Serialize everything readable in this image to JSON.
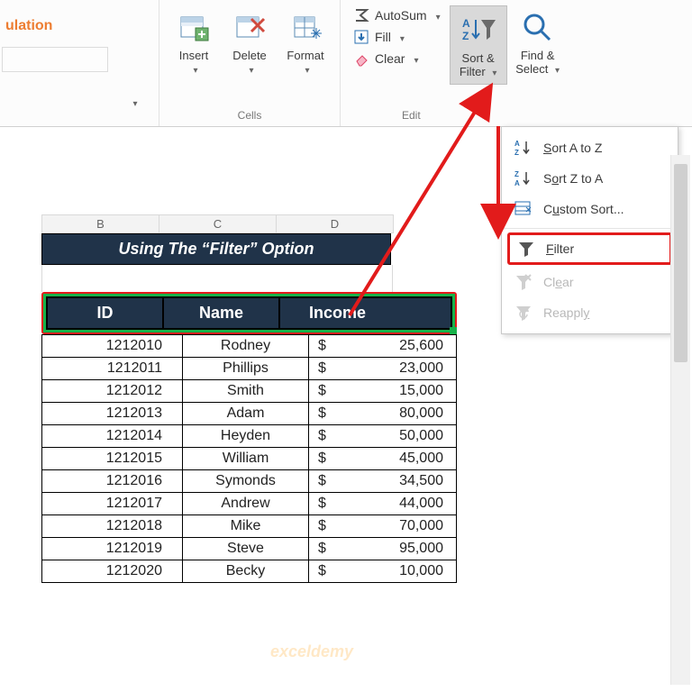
{
  "leftfrag": {
    "line1": "ulation"
  },
  "ribbon": {
    "cells": {
      "insert": "Insert",
      "delete": "Delete",
      "format": "Format",
      "label": "Cells"
    },
    "editing": {
      "autosum": "AutoSum",
      "fill": "Fill",
      "clear": "Clear",
      "sortfilter_l1": "Sort &",
      "sortfilter_l2": "Filter",
      "findselect_l1": "Find &",
      "findselect_l2": "Select",
      "label": "Edit"
    }
  },
  "dropdown": {
    "sort_az_pre": "S",
    "sort_az_rest": "ort A to Z",
    "sort_za_pre": "S",
    "sort_za_mid": "o",
    "sort_za_rest": "rt Z to A",
    "custom_pre": "C",
    "custom_mid": "u",
    "custom_rest": "stom Sort...",
    "filter_pre": "",
    "filter_u": "F",
    "filter_rest": "ilter",
    "clear_pre": "Cl",
    "clear_u": "e",
    "clear_rest": "ar",
    "reapply_pre": "Reappl",
    "reapply_u": "y",
    "reapply_rest": ""
  },
  "sheet": {
    "cols": [
      "B",
      "C",
      "D"
    ],
    "banner": "Using The “Filter” Option",
    "headers": [
      "ID",
      "Name",
      "Income"
    ]
  },
  "watermark": "exceldemy",
  "chart_data": {
    "type": "table",
    "title": "Using The “Filter” Option",
    "columns": [
      "ID",
      "Name",
      "Income"
    ],
    "rows": [
      {
        "id": "1212010",
        "name": "Rodney",
        "income": 25600,
        "income_display": "25,600"
      },
      {
        "id": "1212011",
        "name": "Phillips",
        "income": 23000,
        "income_display": "23,000"
      },
      {
        "id": "1212012",
        "name": "Smith",
        "income": 15000,
        "income_display": "15,000"
      },
      {
        "id": "1212013",
        "name": "Adam",
        "income": 80000,
        "income_display": "80,000"
      },
      {
        "id": "1212014",
        "name": "Heyden",
        "income": 50000,
        "income_display": "50,000"
      },
      {
        "id": "1212015",
        "name": "William",
        "income": 45000,
        "income_display": "45,000"
      },
      {
        "id": "1212016",
        "name": "Symonds",
        "income": 34500,
        "income_display": "34,500"
      },
      {
        "id": "1212017",
        "name": "Andrew",
        "income": 44000,
        "income_display": "44,000"
      },
      {
        "id": "1212018",
        "name": "Mike",
        "income": 70000,
        "income_display": "70,000"
      },
      {
        "id": "1212019",
        "name": "Steve",
        "income": 95000,
        "income_display": "95,000"
      },
      {
        "id": "1212020",
        "name": "Becky",
        "income": 10000,
        "income_display": "10,000"
      }
    ]
  }
}
